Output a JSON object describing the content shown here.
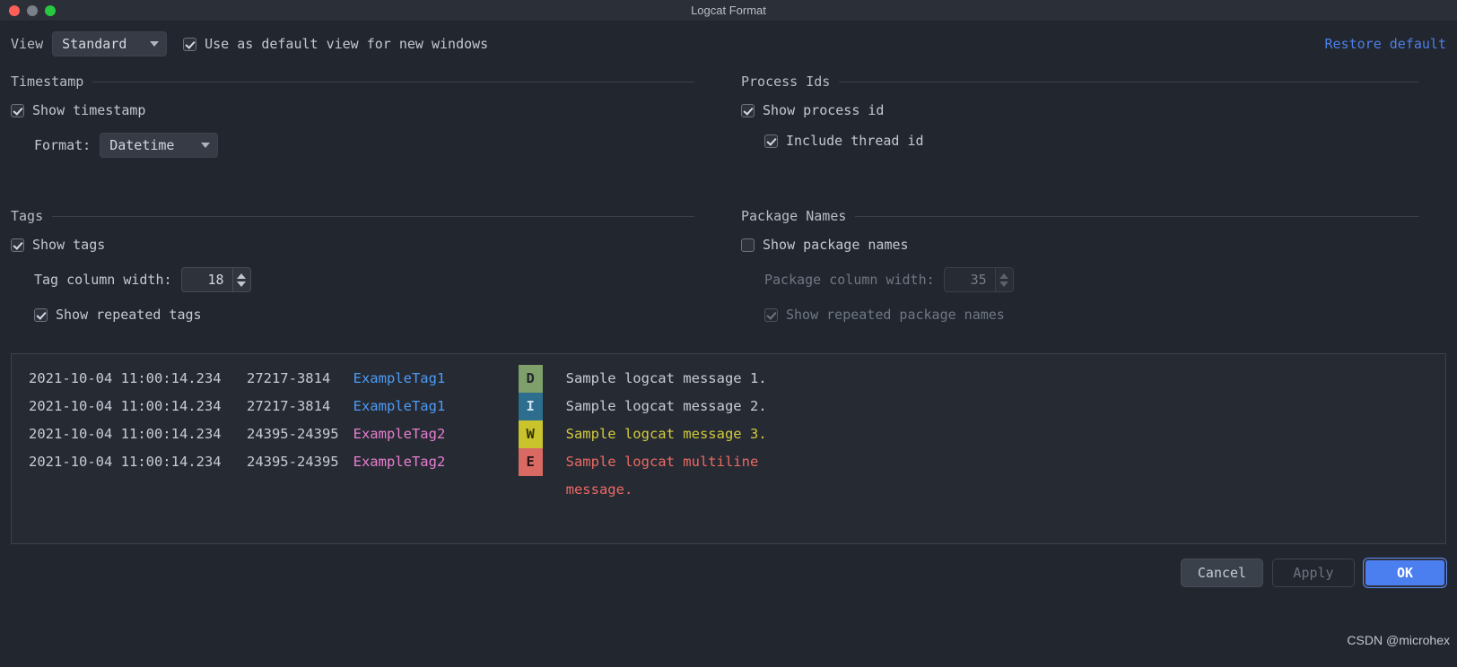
{
  "window": {
    "title": "Logcat Format",
    "traffic_lights": [
      "close-button",
      "minimize-button",
      "maximize-button"
    ]
  },
  "toolbar": {
    "view_label": "View",
    "view_value": "Standard",
    "view_options": [
      "Standard"
    ],
    "default_view_checkbox": {
      "label": "Use as default view for new windows",
      "checked": true
    },
    "restore_default_label": "Restore default",
    "restore_default_color": "#4d7fe8"
  },
  "sections": {
    "timestamp": {
      "title": "Timestamp",
      "show_timestamp": {
        "label": "Show timestamp",
        "checked": true
      },
      "format_label": "Format:",
      "format_value": "Datetime",
      "format_options": [
        "Datetime"
      ]
    },
    "process_ids": {
      "title": "Process Ids",
      "show_process_id": {
        "label": "Show process id",
        "checked": true
      },
      "include_thread_id": {
        "label": "Include thread id",
        "checked": true
      }
    },
    "tags": {
      "title": "Tags",
      "show_tags": {
        "label": "Show tags",
        "checked": true
      },
      "tag_column_width_label": "Tag column width:",
      "tag_column_width_value": "18",
      "show_repeated_tags": {
        "label": "Show repeated tags",
        "checked": true
      }
    },
    "package_names": {
      "title": "Package Names",
      "show_package_names": {
        "label": "Show package names",
        "checked": false
      },
      "package_column_width_label": "Package column width:",
      "package_column_width_value": "35",
      "show_repeated_package_names": {
        "label": "Show repeated package names",
        "checked": true,
        "disabled": true
      }
    }
  },
  "preview": {
    "lines": [
      {
        "timestamp": "2021-10-04 11:00:14.234",
        "pid": "27217-3814 ",
        "tag": "ExampleTag1",
        "tag_color": "#4d9bf5",
        "level": "D",
        "level_bg": "#7f9f6b",
        "message": "Sample logcat message 1.",
        "message_color": "#c6ccd6"
      },
      {
        "timestamp": "2021-10-04 11:00:14.234",
        "pid": "27217-3814 ",
        "tag": "ExampleTag1",
        "tag_color": "#4d9bf5",
        "level": "I",
        "level_bg": "#2d6e8e",
        "message": "Sample logcat message 2.",
        "message_color": "#c6ccd6"
      },
      {
        "timestamp": "2021-10-04 11:00:14.234",
        "pid": "24395-24395",
        "tag": "ExampleTag2",
        "tag_color": "#e87fd1",
        "level": "W",
        "level_bg": "#c9c32c",
        "message": "Sample logcat message 3.",
        "message_color": "#d2cb3c"
      },
      {
        "timestamp": "2021-10-04 11:00:14.234",
        "pid": "24395-24395",
        "tag": "ExampleTag2",
        "tag_color": "#e87fd1",
        "level": "E",
        "level_bg": "#d96a63",
        "message": "Sample logcat multiline",
        "message_color": "#ec6a63"
      }
    ],
    "continuation_line": "message."
  },
  "footer": {
    "cancel_label": "Cancel",
    "apply_label": "Apply",
    "ok_label": "OK",
    "ok_color": "#4b7ff0"
  },
  "watermark": "CSDN @microhex"
}
